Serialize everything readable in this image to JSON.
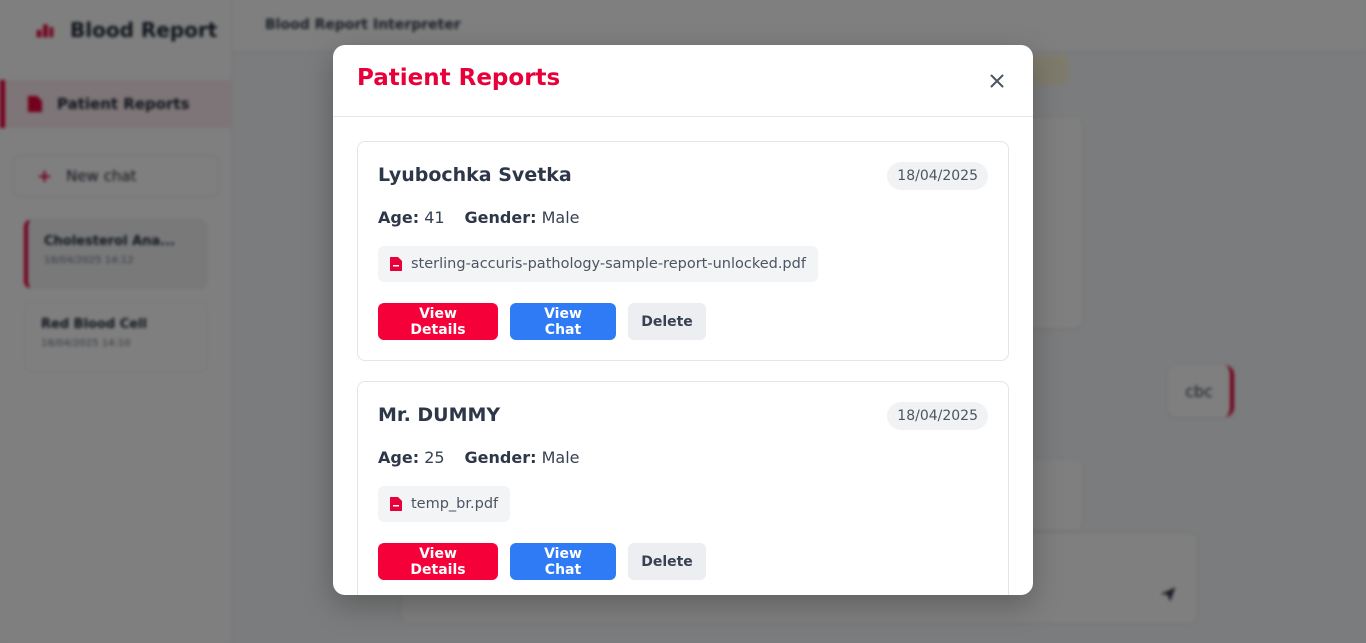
{
  "app": {
    "brand_title": "Blood Report",
    "page_title": "Blood Report Interpreter",
    "sidebar": {
      "patient_reports_label": "Patient Reports",
      "new_chat_label": "New chat",
      "chats": [
        {
          "title": "Cholesterol Ana...",
          "date": "18/04/2025 14:12"
        },
        {
          "title": "Red Blood Cell",
          "date": "18/04/2025 14:10"
        }
      ]
    },
    "user_message": "cbc",
    "colors": {
      "accent": "#e8003a",
      "primary_blue": "#2f7bf5"
    }
  },
  "modal": {
    "title": "Patient Reports",
    "close_icon": "close-icon",
    "reports": [
      {
        "name": "Lyubochka Svetka",
        "date": "18/04/2025",
        "age_label": "Age:",
        "age": "41",
        "gender_label": "Gender:",
        "gender": "Male",
        "file": "sterling-accuris-pathology-sample-report-unlocked.pdf",
        "view_details": "View Details",
        "view_chat": "View Chat",
        "delete": "Delete"
      },
      {
        "name": "Mr. DUMMY",
        "date": "18/04/2025",
        "age_label": "Age:",
        "age": "25",
        "gender_label": "Gender:",
        "gender": "Male",
        "file": "temp_br.pdf",
        "view_details": "View Details",
        "view_chat": "View Chat",
        "delete": "Delete"
      }
    ]
  }
}
